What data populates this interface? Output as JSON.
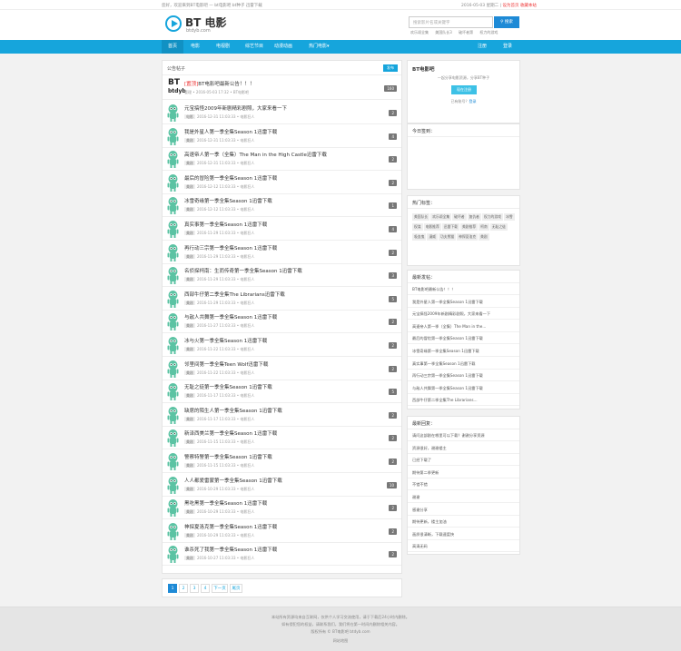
{
  "topbar": {
    "left": "您好，欢迎来到BT电影吧 — bt电影吧 bt种子 迅雷下载",
    "right": "2016-05-03 星期二 |",
    "right_link": "设为首页 收藏本站"
  },
  "logo": {
    "title": "BT 电影",
    "subtitle": "btdyb.com"
  },
  "search": {
    "placeholder": "搜索影片名或关键字",
    "button": "搜索"
  },
  "hot_searches": [
    "欢乐颂全集",
    "美国队长3",
    "破坏者第",
    "权力的游戏"
  ],
  "nav": {
    "items": [
      "首页",
      "电影",
      "电视剧",
      "综艺节目",
      "动漫动画",
      "热门电影▾"
    ],
    "right": [
      "注册",
      "登录"
    ]
  },
  "list": {
    "header": "公告帖子",
    "header_badge": "发布",
    "pinned": {
      "bt": "BT",
      "bt2": "btdyb",
      "prefix": "[置顶]",
      "title": "BT电影吧最新公告！！！",
      "meta": "管理 • 2016-05-03 17:32 • BT电影吧",
      "count": "160"
    },
    "rows": [
      {
        "title": "元宝搞怪2009年新剧精彩剧照，大家来看一下",
        "tag": "电影",
        "meta": "2016-12-31 11:03:33 • 电影狂人",
        "count": "2"
      },
      {
        "title": "我是外星人第一季全集Season 1迅雷下载",
        "tag": "美剧",
        "meta": "2016-12-31 11:03:33 • 电影狂人",
        "count": "4"
      },
      {
        "title": "高速帝人第一季（全集）The Man in the High Castle迅雷下载",
        "tag": "美剧",
        "meta": "2016-12-31 11:03:33 • 电影狂人",
        "count": "2"
      },
      {
        "title": "最后的冒险第一季全集Season 1迅雷下载",
        "tag": "美剧",
        "meta": "2016-12-12 11:03:33 • 电影狂人",
        "count": "2"
      },
      {
        "title": "冰雪奇缘第一季全集Season 1迅雷下载",
        "tag": "美剧",
        "meta": "2016-12-12 11:03:33 • 电影狂人",
        "count": "1"
      },
      {
        "title": "真实事第一季全集Season 1迅雷下载",
        "tag": "美剧",
        "meta": "2016-11-29 11:03:33 • 电影狂人",
        "count": "4"
      },
      {
        "title": "再行动三宗第一季全集Season 1迅雷下载",
        "tag": "美剧",
        "meta": "2016-11-29 11:03:33 • 电影狂人",
        "count": "2"
      },
      {
        "title": "名侦探柯南：生而传奇第一季全集Season 1迅雷下载",
        "tag": "美剧",
        "meta": "2016-11-29 11:03:33 • 电影狂人",
        "count": "3"
      },
      {
        "title": "西部牛仔第二季全集The Librarians迅雷下载",
        "tag": "美剧",
        "meta": "2016-11-29 11:03:33 • 电影狂人",
        "count": "5"
      },
      {
        "title": "与敌人共舞第一季全集Season 1迅雷下载",
        "tag": "美剧",
        "meta": "2016-11-27 11:03:33 • 电影狂人",
        "count": "2"
      },
      {
        "title": "冰与火第一季全集Season 1迅雷下载",
        "tag": "美剧",
        "meta": "2016-11-22 11:03:33 • 电影狂人",
        "count": "2"
      },
      {
        "title": "邻里间第一季全集Teen Wolf迅雷下载",
        "tag": "美剧",
        "meta": "2016-11-22 11:03:33 • 电影狂人",
        "count": "2"
      },
      {
        "title": "无耻之徒第一季全集Season 1迅雷下载",
        "tag": "美剧",
        "meta": "2016-11-17 11:03:33 • 电影狂人",
        "count": "5"
      },
      {
        "title": "缺席的陌生人第一季全集Season 1迅雷下载",
        "tag": "美剧",
        "meta": "2016-11-17 11:03:33 • 电影狂人",
        "count": "2"
      },
      {
        "title": "新泽西美兰第一季全集Season 1迅雷下载",
        "tag": "美剧",
        "meta": "2016-11-15 11:03:33 • 电影狂人",
        "count": "2"
      },
      {
        "title": "警察特警第一季全集Season 1迅雷下载",
        "tag": "美剧",
        "meta": "2016-11-15 11:03:33 • 电影狂人",
        "count": "2"
      },
      {
        "title": "人人都爱雷蒙第一季全集Season 1迅雷下载",
        "tag": "美剧",
        "meta": "2016-10-29 11:03:33 • 电影狂人",
        "count": "10"
      },
      {
        "title": "黑吃黑第一季全集Season 1迅雷下载",
        "tag": "美剧",
        "meta": "2016-10-29 11:03:33 • 电影狂人",
        "count": "2"
      },
      {
        "title": "神探夏洛克第一季全集Season 1迅雷下载",
        "tag": "美剧",
        "meta": "2016-10-29 11:03:33 • 电影狂人",
        "count": "2"
      },
      {
        "title": "谁杀死了我第一季全集Season 1迅雷下载",
        "tag": "美剧",
        "meta": "2016-10-27 11:03:33 • 电影狂人",
        "count": "2"
      }
    ]
  },
  "pager": {
    "pages": [
      "1",
      "2",
      "3",
      "4"
    ],
    "next": "下一页",
    "last": "尾页"
  },
  "side_intro": {
    "title": "BT电影吧",
    "desc": "一起分享电影资源，分享BT种子",
    "button": "现在注册",
    "link_text": "已有账号？",
    "link": "登录"
  },
  "side_today": {
    "title": "今日签到："
  },
  "side_tags": {
    "title": "热门标签：",
    "tags": [
      "美国队长",
      "欢乐颂全集",
      "破坏者",
      "复仇者",
      "权力的游戏",
      "冰雪",
      "权谋",
      "电影推荐",
      "迅雷下载",
      "美剧推荐",
      "柯南",
      "无耻之徒",
      "吸血鬼",
      "漫威",
      "功夫熊猫",
      "神探夏洛克",
      "美剧"
    ]
  },
  "side_latest": {
    "title": "最新发帖：",
    "items": [
      "BT电影吧最新公告！！！",
      "我是外星人第一季全集Season 1迅雷下载",
      "元宝搞怪2009年新剧精彩剧照，大家来看一下",
      "高速帝人第一季（全集）The Man in the...",
      "最后的冒险第一季全集Season 1迅雷下载",
      "冰雪奇缘第一季全集Season 1迅雷下载",
      "真实事第一季全集Season 1迅雷下载",
      "再行动三宗第一季全集Season 1迅雷下载",
      "与敌人共舞第一季全集Season 1迅雷下载",
      "西部牛仔第二季全集The Librarians..."
    ]
  },
  "side_reply": {
    "title": "最新回复：",
    "items": [
      "请问这部剧在哪里可以下载？谢谢分享资源",
      "资源很好，谢谢楼主",
      "已经下载了",
      "期待第二季更新",
      "不错不错",
      "谢谢",
      "感谢分享",
      "期待更新，楼主加油",
      "画质很清晰，下载速度快",
      "高清无码"
    ]
  },
  "footer": {
    "lines": [
      "本站所有资源均来自互联网，仅供个人学习交流使用，请于下载后24小时内删除。",
      "如有侵犯您的权益，请联系我们，我们将在第一时间内删除相关内容。",
      "版权所有 © BT电影吧 btdyb.com"
    ],
    "bottom": "网站地图"
  }
}
